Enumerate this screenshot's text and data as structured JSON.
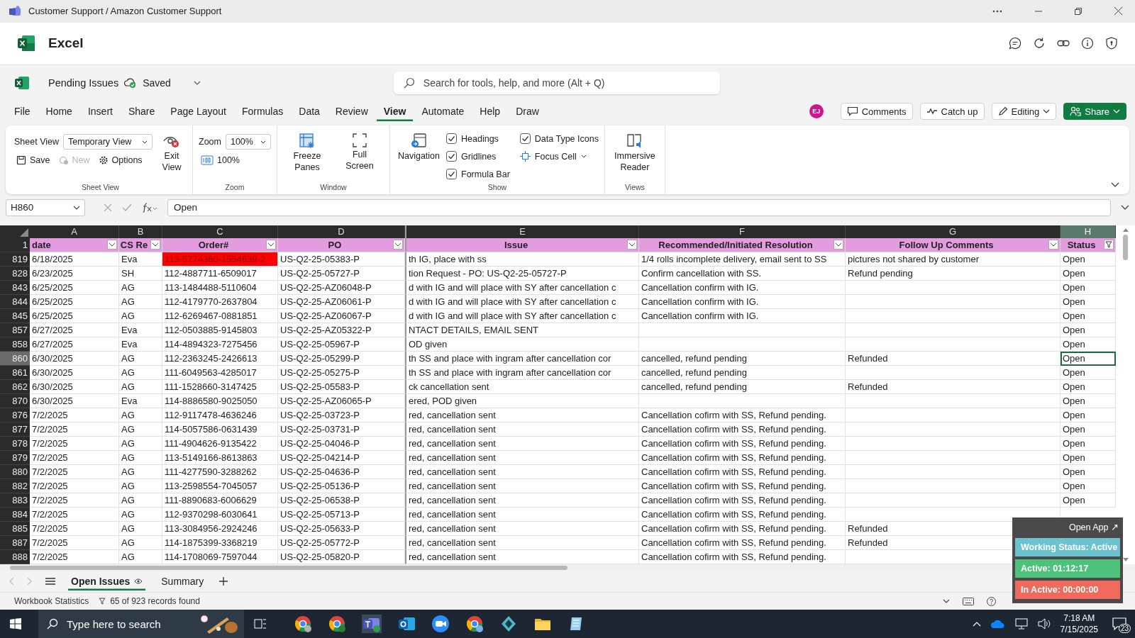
{
  "window": {
    "title": "Customer Support / Amazon Customer Support"
  },
  "app": {
    "name": "Excel"
  },
  "document": {
    "name": "Pending Issues",
    "save_status": "Saved"
  },
  "search": {
    "placeholder": "Search for tools, help, and more (Alt + Q)"
  },
  "ribbon_tabs": [
    {
      "label": "File",
      "selected": false
    },
    {
      "label": "Home",
      "selected": false
    },
    {
      "label": "Insert",
      "selected": false
    },
    {
      "label": "Share",
      "selected": false
    },
    {
      "label": "Page Layout",
      "selected": false
    },
    {
      "label": "Formulas",
      "selected": false
    },
    {
      "label": "Data",
      "selected": false
    },
    {
      "label": "Review",
      "selected": false
    },
    {
      "label": "View",
      "selected": true
    },
    {
      "label": "Automate",
      "selected": false
    },
    {
      "label": "Help",
      "selected": false
    },
    {
      "label": "Draw",
      "selected": false
    }
  ],
  "user": {
    "initials": "EJ"
  },
  "actions": {
    "comments": "Comments",
    "catch_up": "Catch up",
    "editing": "Editing",
    "share": "Share"
  },
  "ribbon": {
    "sheet_view": {
      "label": "Sheet View",
      "field_label": "Sheet View",
      "value": "Temporary View",
      "buttons": [
        {
          "label": "Save",
          "disabled": false
        },
        {
          "label": "New",
          "disabled": true
        },
        {
          "label": "Options",
          "disabled": false
        }
      ],
      "exit": "Exit View"
    },
    "zoom": {
      "label": "Zoom",
      "field_label": "Zoom",
      "value": "100%",
      "reset": "100%"
    },
    "window": {
      "label": "Window",
      "freeze": "Freeze Panes",
      "full_screen": "Full Screen"
    },
    "show": {
      "label": "Show",
      "navigation": "Navigation",
      "checkboxes": [
        {
          "label": "Headings",
          "checked": true
        },
        {
          "label": "Gridlines",
          "checked": true
        },
        {
          "label": "Formula Bar",
          "checked": true
        },
        {
          "label": "Data Type Icons",
          "checked": true
        }
      ],
      "focus_cell": "Focus Cell"
    },
    "views": {
      "label": "Views",
      "button": "Immersive Reader"
    }
  },
  "formula_bar": {
    "name_box": "H860",
    "formula": "Open"
  },
  "sheet": {
    "corner_row": "1",
    "columns": [
      {
        "letter": "A",
        "header": "date",
        "selected": false,
        "filtered": false
      },
      {
        "letter": "B",
        "header": "CS Re",
        "selected": false,
        "filtered": false
      },
      {
        "letter": "C",
        "header": "Order#",
        "selected": false,
        "filtered": false
      },
      {
        "letter": "D",
        "header": "PO",
        "selected": false,
        "filtered": false
      },
      {
        "letter": "E",
        "header": "Issue",
        "selected": false,
        "filtered": false
      },
      {
        "letter": "F",
        "header": "Recommended/Initiated Resolution",
        "selected": false,
        "filtered": false
      },
      {
        "letter": "G",
        "header": "Follow Up Comments",
        "selected": false,
        "filtered": false
      },
      {
        "letter": "H",
        "header": "Status",
        "selected": true,
        "filtered": true
      }
    ],
    "rows": [
      {
        "num": "819",
        "selected": false,
        "flagged": true,
        "cells": [
          "6/18/2025",
          "Eva",
          "113-5774360-1554639-2",
          "US-Q2-25-05383-P",
          "th IG, place with ss",
          "1/4 rolls incomplete delivery, email sent to SS",
          "pictures not shared by customer",
          "Open"
        ]
      },
      {
        "num": "828",
        "selected": false,
        "flagged": false,
        "cells": [
          "6/23/2025",
          "SH",
          "112-4887711-6509017",
          "US-Q2-25-05727-P",
          "tion Request - PO: US-Q2-25-05727-P",
          "Confirm cancellation with SS.",
          "Refund pending",
          "Open"
        ]
      },
      {
        "num": "843",
        "selected": false,
        "flagged": false,
        "cells": [
          "6/25/2025",
          "AG",
          "113-1484488-5110604",
          "US-Q2-25-AZ06048-P",
          "d with IG and will place with SY after cancellation c",
          "Cancellation confirm with IG.",
          "",
          "Open"
        ]
      },
      {
        "num": "844",
        "selected": false,
        "flagged": false,
        "cells": [
          "6/25/2025",
          "AG",
          "112-4179770-2637804",
          "US-Q2-25-AZ06061-P",
          "d with IG and will place with SY after cancellation c",
          "Cancellation confirm with IG.",
          "",
          "Open"
        ]
      },
      {
        "num": "845",
        "selected": false,
        "flagged": false,
        "cells": [
          "6/25/2025",
          "AG",
          "112-6269467-0881851",
          "US-Q2-25-AZ06067-P",
          "d with IG and will place with SY after cancellation c",
          "Cancellation confirm with IG.",
          "",
          "Open"
        ]
      },
      {
        "num": "857",
        "selected": false,
        "flagged": false,
        "cells": [
          "6/27/2025",
          "Eva",
          "112-0503885-9145803",
          "US-Q2-25-AZ05322-P",
          "NTACT DETAILS, EMAIL SENT",
          "",
          "",
          "Open"
        ]
      },
      {
        "num": "858",
        "selected": false,
        "flagged": false,
        "cells": [
          "6/27/2025",
          "Eva",
          "114-4894323-7275456",
          "US-Q2-25-05967-P",
          "OD given",
          "",
          "",
          "Open"
        ]
      },
      {
        "num": "860",
        "selected": true,
        "flagged": false,
        "cells": [
          "6/30/2025",
          "AG",
          "112-2363245-2426613",
          "US-Q2-25-05299-P",
          "th SS and place with ingram after cancellation cor",
          "cancelled, refund pending",
          "Refunded",
          "Open"
        ]
      },
      {
        "num": "861",
        "selected": false,
        "flagged": false,
        "cells": [
          "6/30/2025",
          "AG",
          "111-6049563-4285017",
          "US-Q2-25-05275-P",
          "th SS and place with ingram after cancellation cor",
          "cancelled, refund pending",
          "",
          "Open"
        ]
      },
      {
        "num": "862",
        "selected": false,
        "flagged": false,
        "cells": [
          "6/30/2025",
          "AG",
          "111-1528660-3147425",
          "US-Q2-25-05583-P",
          "ck cancellation sent",
          "cancelled, refund pending",
          "Refunded",
          "Open"
        ]
      },
      {
        "num": "870",
        "selected": false,
        "flagged": false,
        "cells": [
          "6/30/2025",
          "Eva",
          "114-8886580-9025050",
          "US-Q2-25-AZ06065-P",
          "ered, POD given",
          "",
          "",
          "Open"
        ]
      },
      {
        "num": "876",
        "selected": false,
        "flagged": false,
        "cells": [
          "7/2/2025",
          "AG",
          "112-9117478-4636246",
          "US-Q2-25-03723-P",
          "red, cancellation sent",
          "Cancellation cofirm with SS, Refund pending.",
          "",
          "Open"
        ]
      },
      {
        "num": "877",
        "selected": false,
        "flagged": false,
        "cells": [
          "7/2/2025",
          "AG",
          "114-5057586-0631439",
          "US-Q2-25-03731-P",
          "red, cancellation sent",
          "Cancellation cofirm with SS, Refund pending.",
          "",
          "Open"
        ]
      },
      {
        "num": "878",
        "selected": false,
        "flagged": false,
        "cells": [
          "7/2/2025",
          "AG",
          "111-4904626-9135422",
          "US-Q2-25-04046-P",
          "red, cancellation sent",
          "Cancellation cofirm with SS, Refund pending.",
          "",
          "Open"
        ]
      },
      {
        "num": "879",
        "selected": false,
        "flagged": false,
        "cells": [
          "7/2/2025",
          "AG",
          "113-5149166-8613863",
          "US-Q2-25-04214-P",
          "red, cancellation sent",
          "Cancellation cofirm with SS, Refund pending.",
          "",
          "Open"
        ]
      },
      {
        "num": "880",
        "selected": false,
        "flagged": false,
        "cells": [
          "7/2/2025",
          "AG",
          "111-4277590-3288262",
          "US-Q2-25-04636-P",
          "red, cancellation sent",
          "Cancellation cofirm with SS, Refund pending.",
          "",
          "Open"
        ]
      },
      {
        "num": "882",
        "selected": false,
        "flagged": false,
        "cells": [
          "7/2/2025",
          "AG",
          "113-2598554-7045057",
          "US-Q2-25-05136-P",
          "red, cancellation sent",
          "Cancellation cofirm with SS, Refund pending.",
          "",
          "Open"
        ]
      },
      {
        "num": "883",
        "selected": false,
        "flagged": false,
        "cells": [
          "7/2/2025",
          "AG",
          "111-8890683-6006629",
          "US-Q2-25-06538-P",
          "red, cancellation sent",
          "Cancellation cofirm with SS, Refund pending.",
          "",
          "Open"
        ]
      },
      {
        "num": "884",
        "selected": false,
        "flagged": false,
        "cells": [
          "7/2/2025",
          "AG",
          "112-9370298-6030641",
          "US-Q2-25-05713-P",
          "red, cancellation sent",
          "Cancellation cofirm with SS, Refund pending.",
          "",
          ""
        ]
      },
      {
        "num": "885",
        "selected": false,
        "flagged": false,
        "cells": [
          "7/2/2025",
          "AG",
          "113-3084956-2924246",
          "US-Q2-25-05633-P",
          "red, cancellation sent",
          "Cancellation cofirm with SS, Refund pending.",
          "Refunded",
          ""
        ]
      },
      {
        "num": "887",
        "selected": false,
        "flagged": false,
        "cells": [
          "7/2/2025",
          "AG",
          "114-1875399-3368219",
          "US-Q2-25-05772-P",
          "red, cancellation sent",
          "Cancellation cofirm with SS, Refund pending.",
          "Refunded",
          ""
        ]
      },
      {
        "num": "888",
        "selected": false,
        "flagged": false,
        "cells": [
          "7/2/2025",
          "AG",
          "114-1708069-7597044",
          "US-Q2-25-05820-P",
          "red, cancellation sent",
          "Cancellation cofirm with SS, Refund pending.",
          "",
          ""
        ]
      }
    ]
  },
  "sheet_tabs": [
    {
      "label": "Open Issues",
      "selected": true
    },
    {
      "label": "Summary",
      "selected": false
    }
  ],
  "status_bar": {
    "statistics": "Workbook Statistics",
    "records": "65 of 923 records found"
  },
  "tracker": {
    "open_app": "Open App ↗",
    "items": [
      {
        "text": "Working Status: Active",
        "color": "#6cc3cf"
      },
      {
        "text": "Active: 01:12:17",
        "color": "#4cc27a"
      },
      {
        "text": "In Active: 00:00:00",
        "color": "#ef6a5c"
      }
    ]
  },
  "taskbar": {
    "search_placeholder": "Type here to search",
    "time": "7:18 AM",
    "date": "7/15/2025",
    "notifications": "23"
  }
}
